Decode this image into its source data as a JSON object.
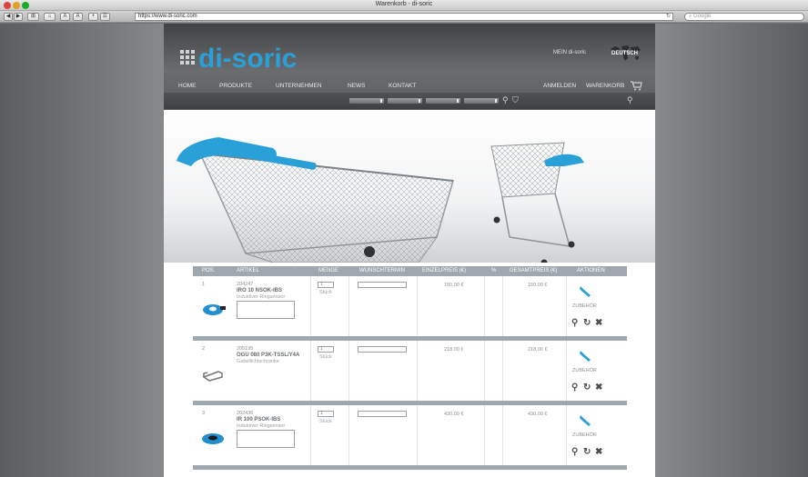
{
  "browser": {
    "window_title": "Warenkorb - di-soric",
    "url": "https://www.di-soric.com",
    "search_placeholder": "Google",
    "nav_buttons": [
      "◀",
      "▶",
      "⊞",
      "⌂",
      "A",
      "A",
      "+",
      "☰"
    ]
  },
  "header": {
    "brand": "di-soric",
    "mein": "MEIN di-soric",
    "language": "DEUTSCH",
    "nav": [
      "HOME",
      "PRODUKTE",
      "UNTERNEHMEN",
      "NEWS",
      "KONTAKT"
    ],
    "account": "ANMELDEN",
    "cart": "WARENKORB"
  },
  "table": {
    "columns": [
      "POS.",
      "ARTIKEL",
      "MENGE",
      "WUNSCHTERMIN",
      "EINZELPREIS (€)",
      "%",
      "GESAMTPREIS (€)",
      "AKTIONEN"
    ],
    "accessory_label": "ZUBEHÖR",
    "rows": [
      {
        "pos": "1",
        "number": "204247",
        "name": "IRO 10 NSOK-IBS",
        "desc": "Induktiver Ringsensor",
        "qty": "1",
        "unit": "Stück",
        "unit_price": "150,00 €",
        "total": "150,00 €"
      },
      {
        "pos": "2",
        "number": "205195",
        "name": "OGU 080 P3K-TSSL/Y4A",
        "desc": "Gabellichtschranke",
        "qty": "1",
        "unit": "Stück",
        "unit_price": "218,00 €",
        "total": "218,00 €"
      },
      {
        "pos": "3",
        "number": "202436",
        "name": "IR 100 PSOK-IBS",
        "desc": "Induktiver Ringsensor",
        "qty": "1",
        "unit": "Stück",
        "unit_price": "430,00 €",
        "total": "430,00 €"
      }
    ]
  },
  "colors": {
    "brand": "#2aa0d8",
    "header_dark": "#404244",
    "table_header": "#9ea8ae"
  }
}
